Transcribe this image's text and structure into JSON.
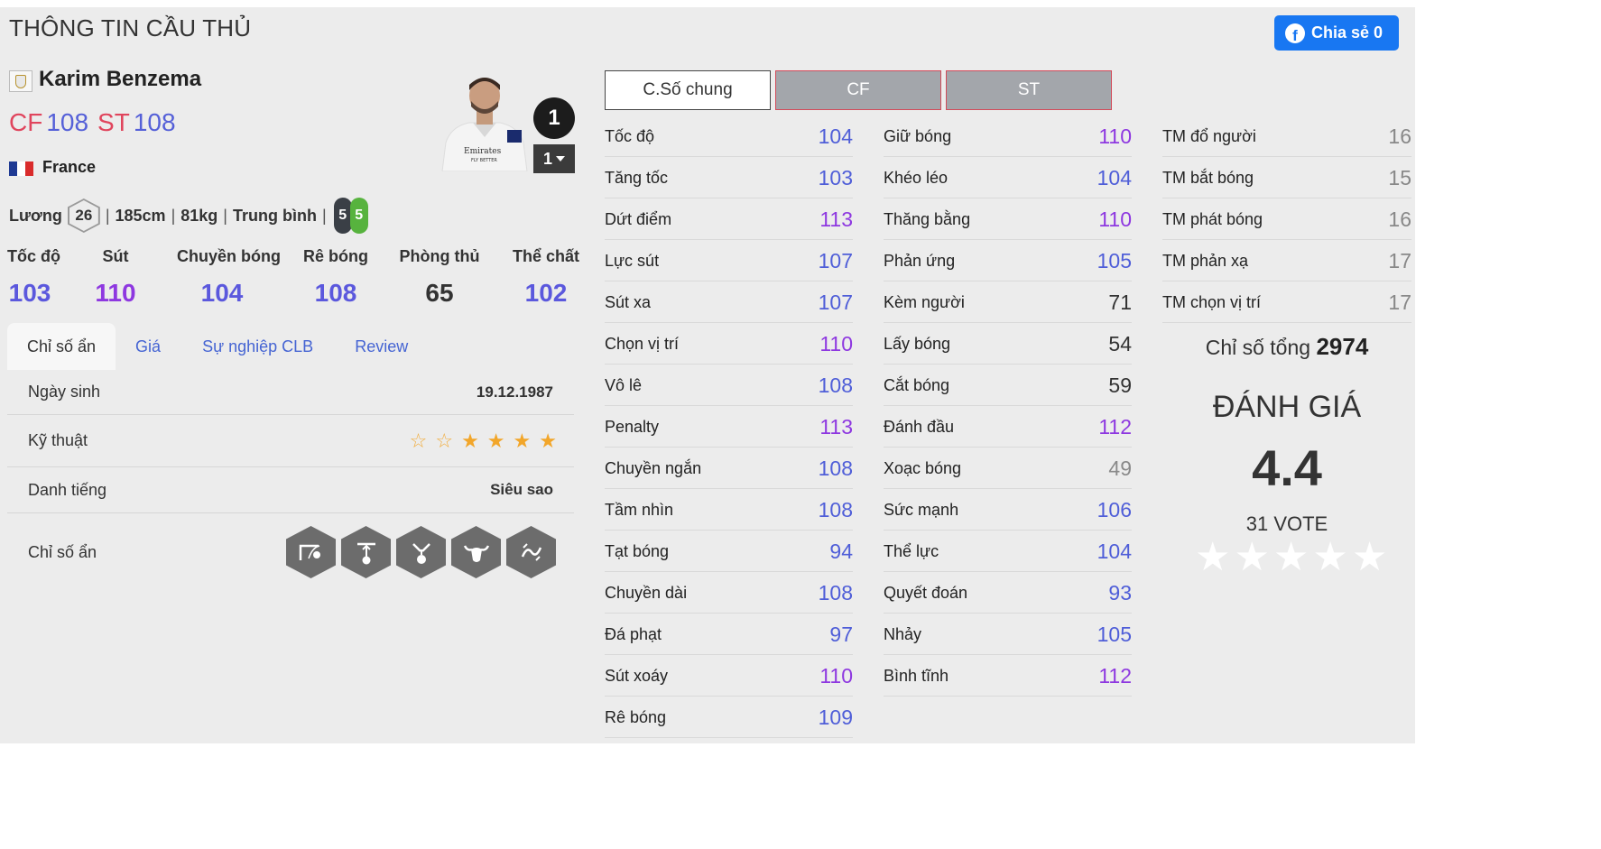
{
  "page": {
    "title": "THÔNG TIN CẦU THỦ",
    "share_label": "Chia sẻ 0"
  },
  "player": {
    "name": "Karim Benzema",
    "positions": [
      {
        "pos": "CF",
        "rating": "108"
      },
      {
        "pos": "ST",
        "rating": "108"
      }
    ],
    "nation": "France",
    "salary_label": "Lương",
    "salary": "26",
    "height": "185cm",
    "weight": "81kg",
    "body_type": "Trung bình",
    "left_foot": "5",
    "right_foot": "5",
    "number": "1",
    "number_select": "1",
    "colors": {
      "pos": "#e0455d",
      "rating": "#5560d8",
      "left_foot": "#3a3f46",
      "right_foot": "#57b33e"
    }
  },
  "main_stats": [
    {
      "label": "Tốc độ",
      "value": "103",
      "color": "#5b58dd"
    },
    {
      "label": "Sút",
      "value": "110",
      "color": "#8e38e0"
    },
    {
      "label": "Chuyền bóng",
      "value": "104",
      "color": "#5b58dd"
    },
    {
      "label": "Rê bóng",
      "value": "108",
      "color": "#5b58dd"
    },
    {
      "label": "Phòng thủ",
      "value": "65",
      "color": "#333333"
    },
    {
      "label": "Thể chất",
      "value": "102",
      "color": "#5b58dd"
    }
  ],
  "tabs": [
    "Chỉ số ẩn",
    "Giá",
    "Sự nghiệp CLB",
    "Review"
  ],
  "details": {
    "birth_label": "Ngày sinh",
    "birth": "19.12.1987",
    "skill_label": "Kỹ thuật",
    "skill_stars": 4,
    "skill_stars_total": 6,
    "fame_label": "Danh tiếng",
    "fame": "Siêu sao",
    "traits_label": "Chỉ số ẩn",
    "traits_icons": [
      "chip-shot-icon",
      "power-header-icon",
      "flair-icon",
      "bull-icon",
      "dribbler-icon"
    ]
  },
  "position_tabs": [
    "C.Số chung",
    "CF",
    "ST"
  ],
  "stats_col1": [
    {
      "label": "Tốc độ",
      "value": "104"
    },
    {
      "label": "Tăng tốc",
      "value": "103"
    },
    {
      "label": "Dứt điểm",
      "value": "113"
    },
    {
      "label": "Lực sút",
      "value": "107"
    },
    {
      "label": "Sút xa",
      "value": "107"
    },
    {
      "label": "Chọn vị trí",
      "value": "110"
    },
    {
      "label": "Vô lê",
      "value": "108"
    },
    {
      "label": "Penalty",
      "value": "113"
    },
    {
      "label": "Chuyền ngắn",
      "value": "108"
    },
    {
      "label": "Tầm nhìn",
      "value": "108"
    },
    {
      "label": "Tạt bóng",
      "value": "94"
    },
    {
      "label": "Chuyền dài",
      "value": "108"
    },
    {
      "label": "Đá phạt",
      "value": "97"
    },
    {
      "label": "Sút xoáy",
      "value": "110"
    },
    {
      "label": "Rê bóng",
      "value": "109"
    }
  ],
  "stats_col2": [
    {
      "label": "Giữ bóng",
      "value": "110"
    },
    {
      "label": "Khéo léo",
      "value": "104"
    },
    {
      "label": "Thăng bằng",
      "value": "110"
    },
    {
      "label": "Phản ứng",
      "value": "105"
    },
    {
      "label": "Kèm người",
      "value": "71"
    },
    {
      "label": "Lấy bóng",
      "value": "54"
    },
    {
      "label": "Cắt bóng",
      "value": "59"
    },
    {
      "label": "Đánh đầu",
      "value": "112"
    },
    {
      "label": "Xoạc bóng",
      "value": "49"
    },
    {
      "label": "Sức mạnh",
      "value": "106"
    },
    {
      "label": "Thể lực",
      "value": "104"
    },
    {
      "label": "Quyết đoán",
      "value": "93"
    },
    {
      "label": "Nhảy",
      "value": "105"
    },
    {
      "label": "Bình tĩnh",
      "value": "112"
    }
  ],
  "stats_col3": [
    {
      "label": "TM đổ người",
      "value": "16"
    },
    {
      "label": "TM bắt bóng",
      "value": "15"
    },
    {
      "label": "TM phát bóng",
      "value": "16"
    },
    {
      "label": "TM phản xạ",
      "value": "17"
    },
    {
      "label": "TM chọn vị trí",
      "value": "17"
    }
  ],
  "total": {
    "label": "Chỉ số tổng",
    "value": "2974"
  },
  "rating": {
    "title": "ĐÁNH GIÁ",
    "score": "4.4",
    "votes": "31 VOTE",
    "stars_total": 5
  },
  "stat_colors": {
    "high": "#8e38e0",
    "good": "#4f5ed8",
    "mid": "#333333",
    "low": "#8a8a8a"
  }
}
